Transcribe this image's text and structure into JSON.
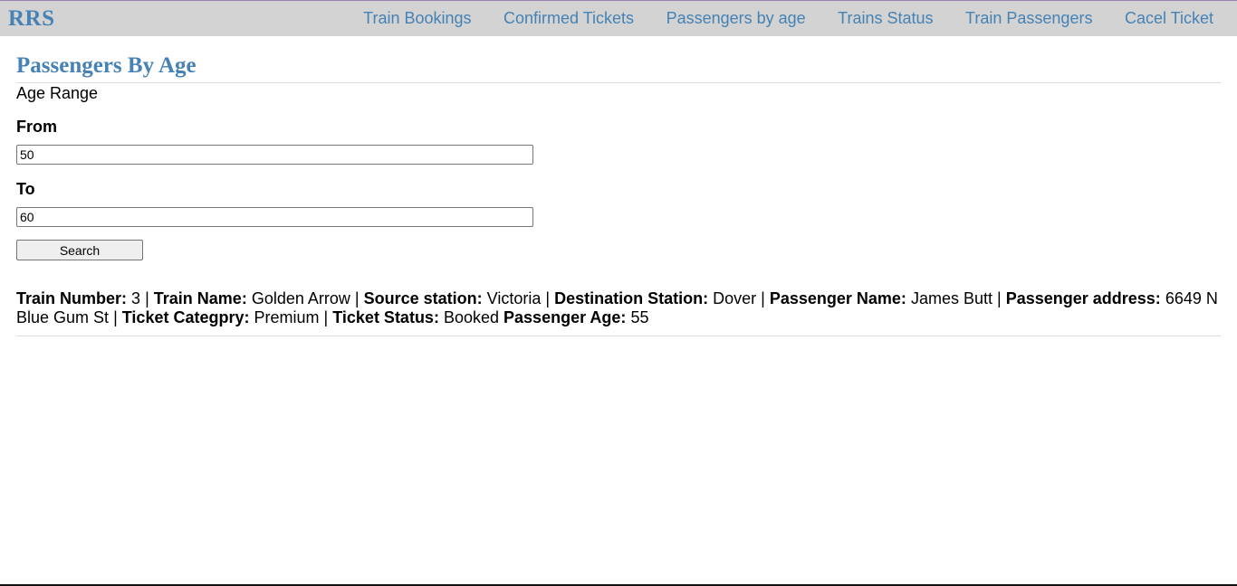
{
  "nav": {
    "brand": "RRS",
    "links": [
      "Train Bookings",
      "Confirmed Tickets",
      "Passengers by age",
      "Trains Status",
      "Train Passengers",
      "Cacel Ticket"
    ]
  },
  "page": {
    "title": "Passengers By Age",
    "subtitle": "Age Range"
  },
  "form": {
    "from_label": "From",
    "from_value": "50",
    "to_label": "To",
    "to_value": "60",
    "search_label": "Search"
  },
  "result": {
    "train_number_label": "Train Number:",
    "train_number": "3",
    "train_name_label": "Train Name:",
    "train_name": "Golden Arrow",
    "source_label": "Source station:",
    "source": "Victoria",
    "destination_label": "Destination Station:",
    "destination": "Dover",
    "passenger_name_label": "Passenger Name:",
    "passenger_name": "James Butt",
    "passenger_address_label": "Passenger address:",
    "passenger_address": "6649 N Blue Gum St",
    "ticket_category_label": "Ticket Categpry:",
    "ticket_category": "Premium",
    "ticket_status_label": "Ticket Status:",
    "ticket_status": "Booked",
    "passenger_age_label": "Passenger Age:",
    "passenger_age": "55",
    "separator": "|"
  },
  "colors": {
    "brand": "#4682b4",
    "navbar_bg": "#d3d3d3"
  }
}
